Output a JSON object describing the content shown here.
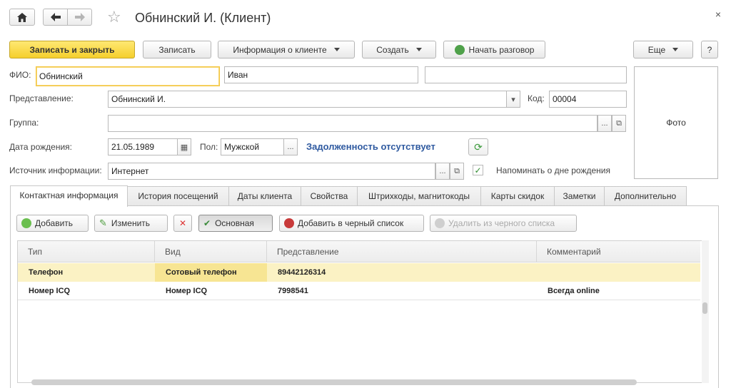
{
  "window": {
    "title": "Обнинский И. (Клиент)",
    "close_glyph": "×",
    "home_icon": "home-icon",
    "back_icon": "arrow-left-icon",
    "forward_icon": "arrow-right-icon",
    "star_icon": "star-icon"
  },
  "toolbar": {
    "save_close": "Записать и закрыть",
    "save": "Записать",
    "client_info": "Информация о клиенте",
    "create": "Создать",
    "start_call": "Начать разговор",
    "more": "Еще",
    "help": "?"
  },
  "form": {
    "fio_label": "ФИО:",
    "last_name": "Обнинский",
    "first_name": "Иван",
    "middle_name": "",
    "representation_label": "Представление:",
    "representation": "Обнинский И.",
    "code_label": "Код:",
    "code": "00004",
    "group_label": "Группа:",
    "group": "",
    "birthdate_label": "Дата рождения:",
    "birthdate": "21.05.1989",
    "gender_label": "Пол:",
    "gender": "Мужской",
    "debt_status": "Задолженность отсутствует",
    "source_label": "Источник информации:",
    "source": "Интернет",
    "remind_birthday": "Напоминать о дне рождения",
    "remind_checked": true,
    "photo": "Фото",
    "ellipsis": "...",
    "open_glyph": "⧉",
    "calendar_glyph": "▦",
    "dropdown_glyph": "▾",
    "check_glyph": "✓",
    "refresh_glyph": "⟳"
  },
  "tabs": [
    "Контактная информация",
    "История посещений",
    "Даты клиента",
    "Свойства",
    "Штрихкоды, магнитокоды",
    "Карты скидок",
    "Заметки",
    "Дополнительно"
  ],
  "contacts_toolbar": {
    "add": "Добавить",
    "edit": "Изменить",
    "delete_glyph": "✕",
    "main": "Основная",
    "add_blacklist": "Добавить в черный список",
    "remove_blacklist": "Удалить из черного списка"
  },
  "contacts_table": {
    "columns": [
      "Тип",
      "Вид",
      "Представление",
      "Комментарий"
    ],
    "rows": [
      {
        "type": "Телефон",
        "kind": "Сотовый телефон",
        "value": "89442126314",
        "comment": ""
      },
      {
        "type": "Номер ICQ",
        "kind": "Номер ICQ",
        "value": "7998541",
        "comment": "Всегда online"
      }
    ]
  },
  "colors": {
    "primary_button": "#f5cf2c",
    "debt_text": "#2f5aa0",
    "selected_row": "#fbf2c4"
  }
}
